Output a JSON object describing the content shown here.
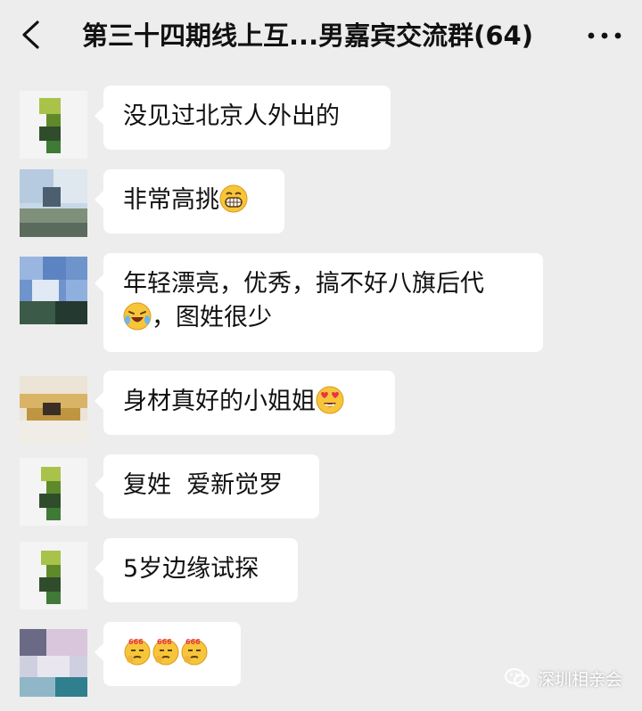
{
  "header": {
    "title": "第三十四期线上互...男嘉宾交流群(64)",
    "back_icon": "chevron-left-icon",
    "more_icon": "more-dots-icon"
  },
  "messages": [
    {
      "text": "没见过北京人外出的",
      "emojis": []
    },
    {
      "text": "非常高挑",
      "emojis": [
        "grin-face-icon"
      ]
    },
    {
      "text_line1": "年轻漂亮，优秀，搞不好八旗后代",
      "text_line2": "，图姓很少",
      "emojis": [
        "sweat-laugh-face-icon"
      ]
    },
    {
      "text": "身材真好的小姐姐",
      "emojis": [
        "heart-eyes-face-icon"
      ]
    },
    {
      "text": "复姓  爱新觉罗",
      "emojis": []
    },
    {
      "text": "5岁边缘试探",
      "emojis": []
    },
    {
      "text": "",
      "emojis": [
        "666-face-icon",
        "666-face-icon",
        "666-face-icon"
      ]
    }
  ],
  "watermark": {
    "text": "深圳相亲会",
    "icon": "wechat-icon"
  },
  "colors": {
    "background": "#ededed",
    "bubble": "#ffffff",
    "text": "#111111"
  }
}
